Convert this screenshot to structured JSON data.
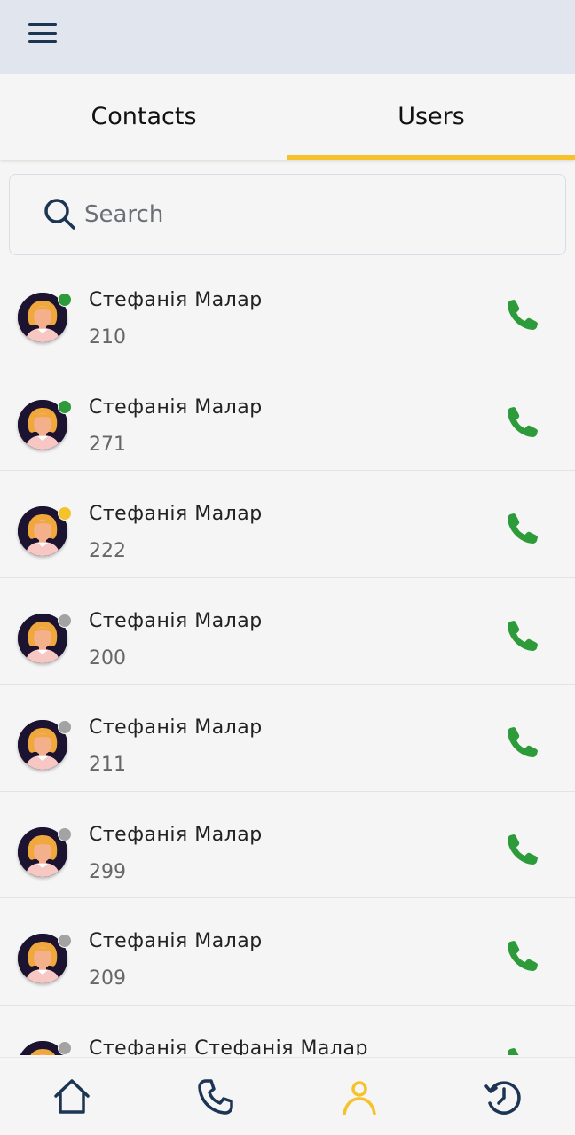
{
  "header": {
    "menu_icon": "hamburger-menu-icon"
  },
  "tabs": [
    {
      "label": "Contacts",
      "active": false
    },
    {
      "label": "Users",
      "active": true
    }
  ],
  "search": {
    "placeholder": "Search",
    "value": ""
  },
  "colors": {
    "accent": "#f6c22b",
    "call_green": "#2e9b3a",
    "online": "#2e9b3a",
    "away": "#f6c22b",
    "offline": "#a3a3a3",
    "navy": "#1c3553"
  },
  "users": [
    {
      "name": "Стефанія Малар",
      "extension": "210",
      "status": "online"
    },
    {
      "name": "Стефанія Малар",
      "extension": "271",
      "status": "online"
    },
    {
      "name": "Стефанія Малар",
      "extension": "222",
      "status": "away"
    },
    {
      "name": "Стефанія Малар",
      "extension": "200",
      "status": "offline"
    },
    {
      "name": "Стефанія Малар",
      "extension": "211",
      "status": "offline"
    },
    {
      "name": "Стефанія Малар",
      "extension": "299",
      "status": "offline"
    },
    {
      "name": "Стефанія Малар",
      "extension": "209",
      "status": "offline"
    },
    {
      "name": "Стефанія Стефанія Малар",
      "extension": "",
      "status": "offline"
    }
  ],
  "bottom_nav": [
    {
      "icon": "home-icon",
      "active": false
    },
    {
      "icon": "phone-icon",
      "active": false
    },
    {
      "icon": "user-icon",
      "active": true
    },
    {
      "icon": "history-icon",
      "active": false
    }
  ]
}
